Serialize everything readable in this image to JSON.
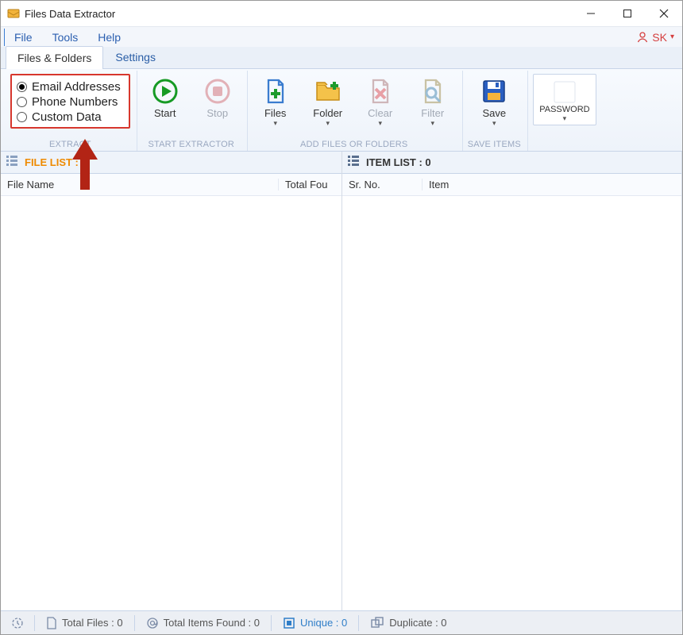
{
  "window": {
    "title": "Files Data Extractor"
  },
  "menu": {
    "file": "File",
    "tools": "Tools",
    "help": "Help",
    "brand": "SK"
  },
  "tabs": {
    "files_folders": "Files & Folders",
    "settings": "Settings"
  },
  "ribbon": {
    "extract": {
      "label": "EXTRACT",
      "options": {
        "email": "Email Addresses",
        "phone": "Phone Numbers",
        "custom": "Custom Data"
      }
    },
    "start_extractor": {
      "label": "START EXTRACTOR",
      "start": "Start",
      "stop": "Stop"
    },
    "add": {
      "label": "ADD FILES OR FOLDERS",
      "files": "Files",
      "folder": "Folder",
      "clear": "Clear",
      "filter": "Filter"
    },
    "save_items": {
      "label": "SAVE ITEMS",
      "save": "Save"
    },
    "password": "PASSWORD"
  },
  "panel_left": {
    "title": "FILE LIST : 0",
    "col1": "File Name",
    "col2": "Total Fou"
  },
  "panel_right": {
    "title": "ITEM LIST : 0",
    "col1": "Sr. No.",
    "col2": "Item"
  },
  "status": {
    "total_files": "Total Files : 0",
    "total_items": "Total Items Found : 0",
    "unique": "Unique : 0",
    "duplicate": "Duplicate : 0"
  }
}
